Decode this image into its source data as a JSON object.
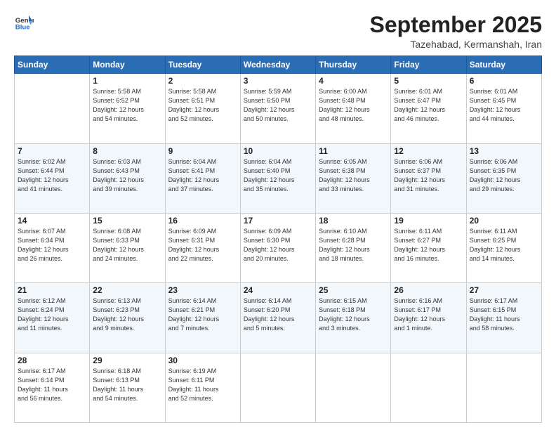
{
  "logo": {
    "general": "General",
    "blue": "Blue"
  },
  "header": {
    "month": "September 2025",
    "location": "Tazehabad, Kermanshah, Iran"
  },
  "weekdays": [
    "Sunday",
    "Monday",
    "Tuesday",
    "Wednesday",
    "Thursday",
    "Friday",
    "Saturday"
  ],
  "weeks": [
    [
      {
        "day": "",
        "info": ""
      },
      {
        "day": "1",
        "info": "Sunrise: 5:58 AM\nSunset: 6:52 PM\nDaylight: 12 hours\nand 54 minutes."
      },
      {
        "day": "2",
        "info": "Sunrise: 5:58 AM\nSunset: 6:51 PM\nDaylight: 12 hours\nand 52 minutes."
      },
      {
        "day": "3",
        "info": "Sunrise: 5:59 AM\nSunset: 6:50 PM\nDaylight: 12 hours\nand 50 minutes."
      },
      {
        "day": "4",
        "info": "Sunrise: 6:00 AM\nSunset: 6:48 PM\nDaylight: 12 hours\nand 48 minutes."
      },
      {
        "day": "5",
        "info": "Sunrise: 6:01 AM\nSunset: 6:47 PM\nDaylight: 12 hours\nand 46 minutes."
      },
      {
        "day": "6",
        "info": "Sunrise: 6:01 AM\nSunset: 6:45 PM\nDaylight: 12 hours\nand 44 minutes."
      }
    ],
    [
      {
        "day": "7",
        "info": "Sunrise: 6:02 AM\nSunset: 6:44 PM\nDaylight: 12 hours\nand 41 minutes."
      },
      {
        "day": "8",
        "info": "Sunrise: 6:03 AM\nSunset: 6:43 PM\nDaylight: 12 hours\nand 39 minutes."
      },
      {
        "day": "9",
        "info": "Sunrise: 6:04 AM\nSunset: 6:41 PM\nDaylight: 12 hours\nand 37 minutes."
      },
      {
        "day": "10",
        "info": "Sunrise: 6:04 AM\nSunset: 6:40 PM\nDaylight: 12 hours\nand 35 minutes."
      },
      {
        "day": "11",
        "info": "Sunrise: 6:05 AM\nSunset: 6:38 PM\nDaylight: 12 hours\nand 33 minutes."
      },
      {
        "day": "12",
        "info": "Sunrise: 6:06 AM\nSunset: 6:37 PM\nDaylight: 12 hours\nand 31 minutes."
      },
      {
        "day": "13",
        "info": "Sunrise: 6:06 AM\nSunset: 6:35 PM\nDaylight: 12 hours\nand 29 minutes."
      }
    ],
    [
      {
        "day": "14",
        "info": "Sunrise: 6:07 AM\nSunset: 6:34 PM\nDaylight: 12 hours\nand 26 minutes."
      },
      {
        "day": "15",
        "info": "Sunrise: 6:08 AM\nSunset: 6:33 PM\nDaylight: 12 hours\nand 24 minutes."
      },
      {
        "day": "16",
        "info": "Sunrise: 6:09 AM\nSunset: 6:31 PM\nDaylight: 12 hours\nand 22 minutes."
      },
      {
        "day": "17",
        "info": "Sunrise: 6:09 AM\nSunset: 6:30 PM\nDaylight: 12 hours\nand 20 minutes."
      },
      {
        "day": "18",
        "info": "Sunrise: 6:10 AM\nSunset: 6:28 PM\nDaylight: 12 hours\nand 18 minutes."
      },
      {
        "day": "19",
        "info": "Sunrise: 6:11 AM\nSunset: 6:27 PM\nDaylight: 12 hours\nand 16 minutes."
      },
      {
        "day": "20",
        "info": "Sunrise: 6:11 AM\nSunset: 6:25 PM\nDaylight: 12 hours\nand 14 minutes."
      }
    ],
    [
      {
        "day": "21",
        "info": "Sunrise: 6:12 AM\nSunset: 6:24 PM\nDaylight: 12 hours\nand 11 minutes."
      },
      {
        "day": "22",
        "info": "Sunrise: 6:13 AM\nSunset: 6:23 PM\nDaylight: 12 hours\nand 9 minutes."
      },
      {
        "day": "23",
        "info": "Sunrise: 6:14 AM\nSunset: 6:21 PM\nDaylight: 12 hours\nand 7 minutes."
      },
      {
        "day": "24",
        "info": "Sunrise: 6:14 AM\nSunset: 6:20 PM\nDaylight: 12 hours\nand 5 minutes."
      },
      {
        "day": "25",
        "info": "Sunrise: 6:15 AM\nSunset: 6:18 PM\nDaylight: 12 hours\nand 3 minutes."
      },
      {
        "day": "26",
        "info": "Sunrise: 6:16 AM\nSunset: 6:17 PM\nDaylight: 12 hours\nand 1 minute."
      },
      {
        "day": "27",
        "info": "Sunrise: 6:17 AM\nSunset: 6:15 PM\nDaylight: 11 hours\nand 58 minutes."
      }
    ],
    [
      {
        "day": "28",
        "info": "Sunrise: 6:17 AM\nSunset: 6:14 PM\nDaylight: 11 hours\nand 56 minutes."
      },
      {
        "day": "29",
        "info": "Sunrise: 6:18 AM\nSunset: 6:13 PM\nDaylight: 11 hours\nand 54 minutes."
      },
      {
        "day": "30",
        "info": "Sunrise: 6:19 AM\nSunset: 6:11 PM\nDaylight: 11 hours\nand 52 minutes."
      },
      {
        "day": "",
        "info": ""
      },
      {
        "day": "",
        "info": ""
      },
      {
        "day": "",
        "info": ""
      },
      {
        "day": "",
        "info": ""
      }
    ]
  ]
}
